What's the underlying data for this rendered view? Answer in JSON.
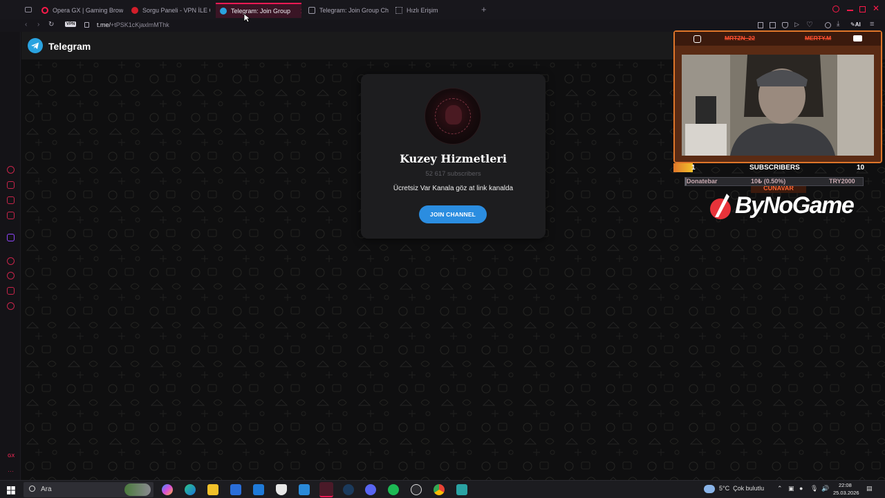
{
  "browser": {
    "tabs": [
      {
        "label": "Opera GX | Gaming Browse",
        "color": "#ff1a4a",
        "active": false
      },
      {
        "label": "Sorgu Paneli - VPN İLE Gİ",
        "color": "#d21e2a",
        "active": false
      },
      {
        "label": "Telegram: Join Group",
        "color": "#2aa3e0",
        "active": true
      },
      {
        "label": "Telegram: Join Group Cha",
        "color": "#9c9aa8",
        "active": false
      },
      {
        "label": "Hızlı Erişim",
        "color": "#9c9aa8",
        "active": false
      }
    ],
    "vpn_label": "VPN",
    "url_host": "t.me/",
    "url_path": "+tPSK1cKjaxlmMThk",
    "accent": "#ff1a55",
    "ai_label": "AI"
  },
  "telegram": {
    "header_title": "Telegram",
    "channel_name": "Kuzey Hizmetleri",
    "subscribers": "52 617 subscribers",
    "description": "Ücretsiz Var Kanala göz at link kanalda",
    "join_label": "JOIN CHANNEL"
  },
  "overlay": {
    "tag_left": "MRTZN_22",
    "tag_right": "MERTY.M",
    "name_tag": "CUNAVAR",
    "subs_left": "1",
    "subs_label": "SUBSCRIBERS",
    "subs_right": "10",
    "donate_left": "Donatebar",
    "donate_mid": "10₺ (0.50%)",
    "donate_right": "TRY2000",
    "donate_progress": 0.005,
    "brand": "ByNoGame",
    "frame_color": "#e0762a"
  },
  "taskbar": {
    "search_placeholder": "Ara",
    "weather": "5°C  Çok bulutlu",
    "time": "22:08",
    "date": "25.03.2026"
  }
}
